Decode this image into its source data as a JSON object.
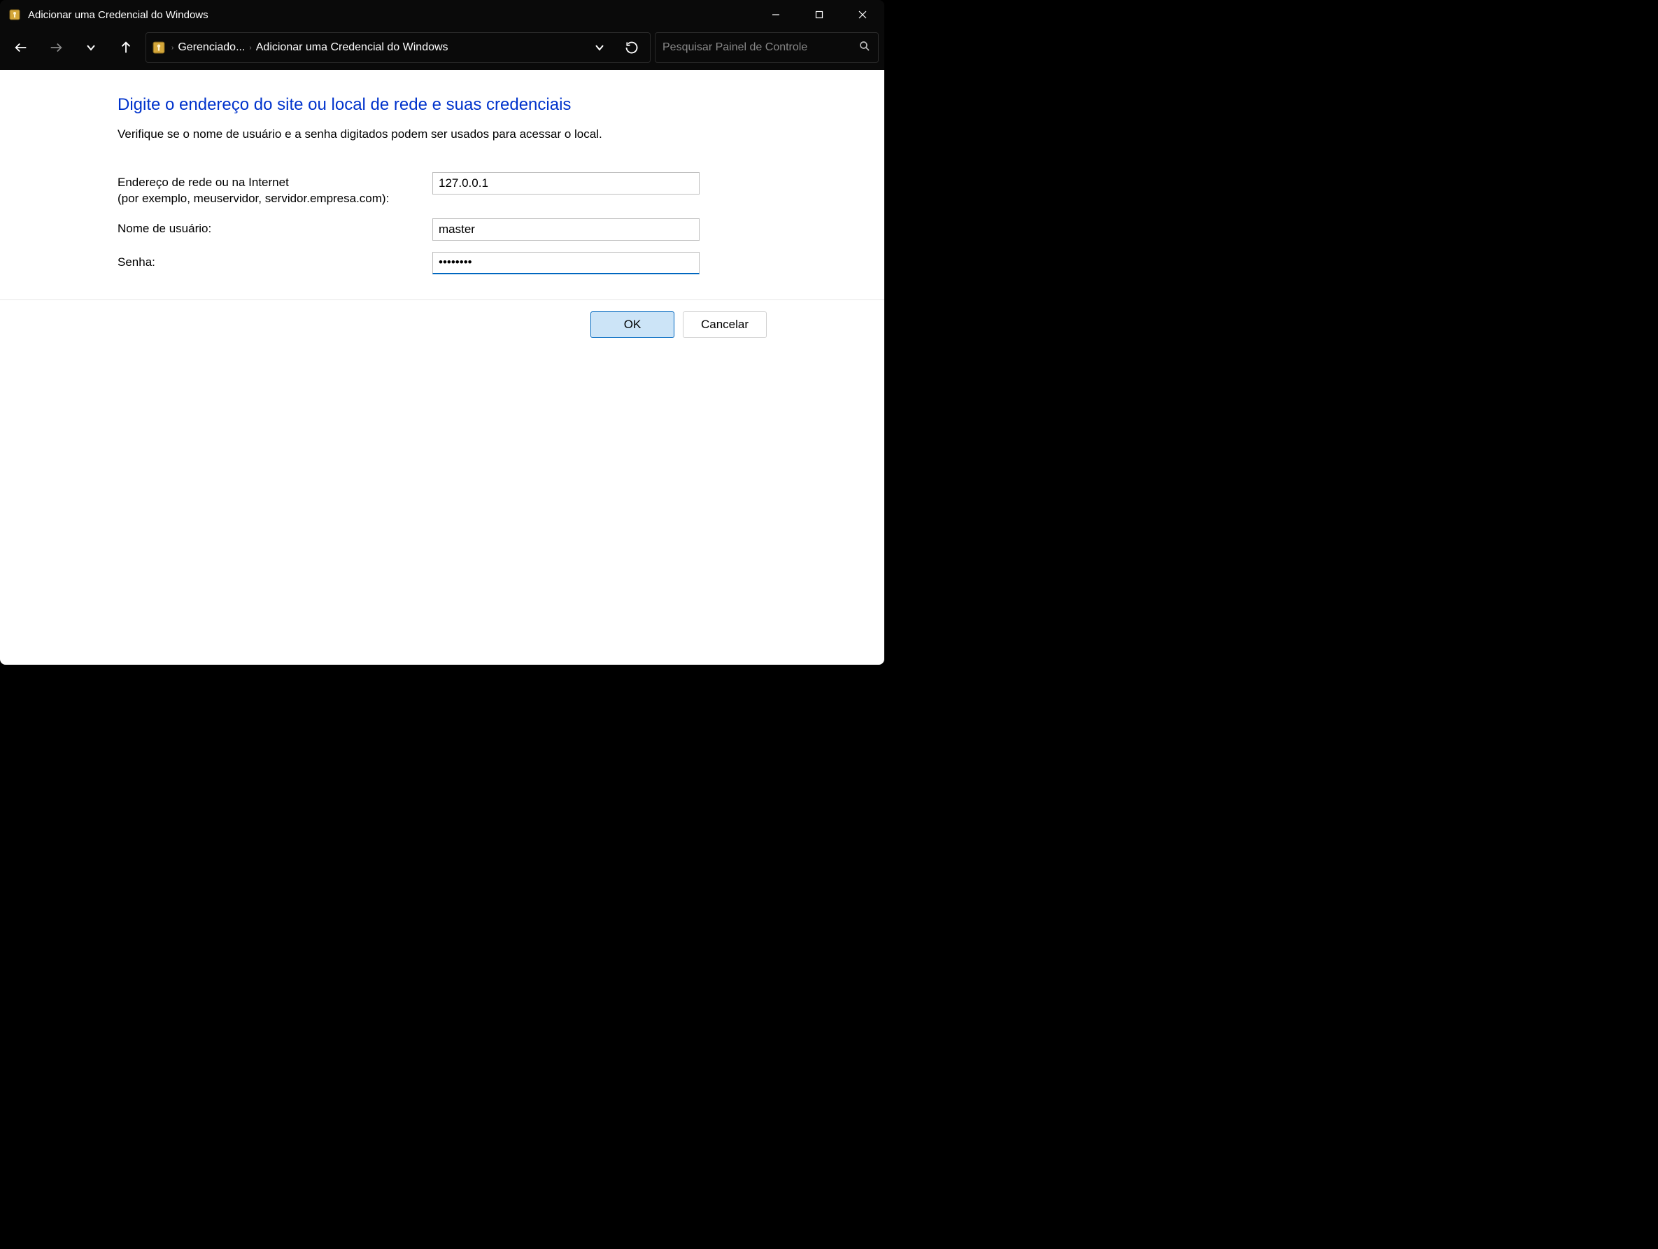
{
  "titlebar": {
    "title": "Adicionar uma Credencial do Windows"
  },
  "navbar": {
    "breadcrumb": {
      "parent": "Gerenciado...",
      "current": "Adicionar uma Credencial do Windows"
    },
    "search_placeholder": "Pesquisar Painel de Controle"
  },
  "form": {
    "heading": "Digite o endereço do site ou local de rede e suas credenciais",
    "subtext": "Verifique se o nome de usuário e a senha digitados podem ser usados para acessar o local.",
    "address_label_line1": "Endereço de rede ou na Internet",
    "address_label_line2": "(por exemplo, meuservidor, servidor.empresa.com):",
    "address_value": "127.0.0.1",
    "username_label": "Nome de usuário:",
    "username_value": "master",
    "password_label": "Senha:",
    "password_value": "••••••••"
  },
  "buttons": {
    "ok": "OK",
    "cancel": "Cancelar"
  }
}
